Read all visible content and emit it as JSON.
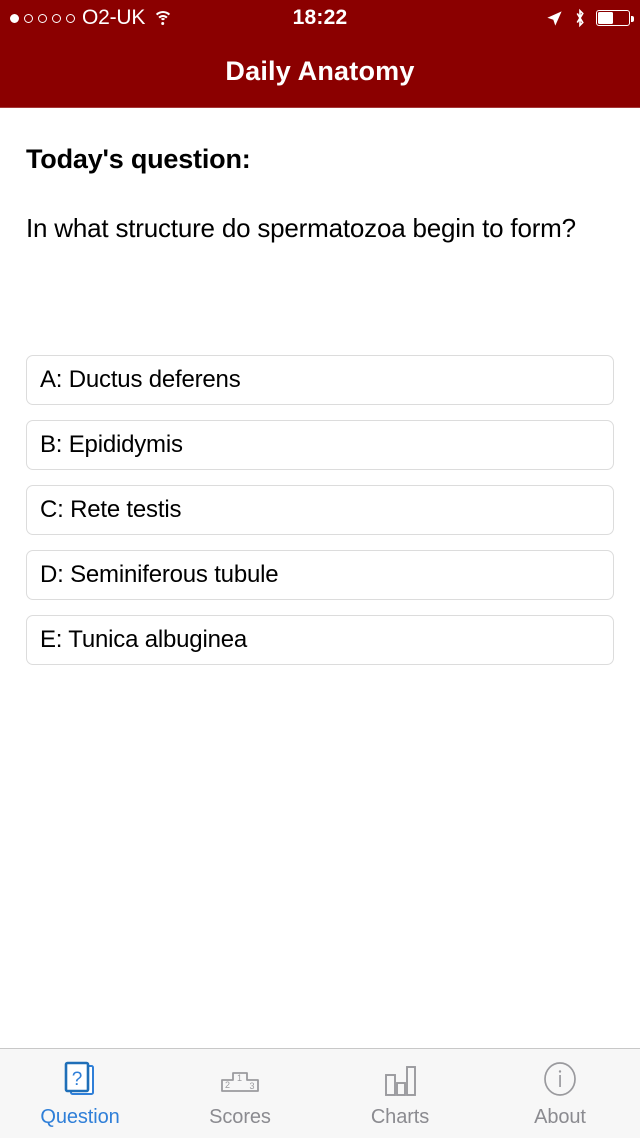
{
  "status_bar": {
    "carrier": "O2-UK",
    "signal_dots_total": 5,
    "signal_dots_filled": 1,
    "wifi_icon": "wifi-icon",
    "time": "18:22",
    "location_icon": "location-arrow-icon",
    "bluetooth_icon": "bluetooth-icon",
    "battery_icon": "battery-icon",
    "battery_percent": 50,
    "background_color": "#8B0000",
    "text_color": "#FFFFFF"
  },
  "navbar": {
    "title": "Daily Anatomy",
    "background_color": "#8B0000",
    "text_color": "#FFFFFF"
  },
  "main": {
    "heading": "Today's question:",
    "question": "In what structure do spermatozoa begin to form?",
    "options": [
      {
        "label": "A: Ductus deferens"
      },
      {
        "label": "B: Epididymis"
      },
      {
        "label": "C: Rete testis"
      },
      {
        "label": "D: Seminiferous tubule"
      },
      {
        "label": "E: Tunica albuginea"
      }
    ]
  },
  "tabbar": {
    "active_color": "#2F7FD8",
    "inactive_color": "#8B8B90",
    "background_color": "#F7F7F7",
    "items": [
      {
        "label": "Question",
        "icon": "question-cards-icon",
        "active": true
      },
      {
        "label": "Scores",
        "icon": "podium-icon",
        "active": false
      },
      {
        "label": "Charts",
        "icon": "bar-chart-icon",
        "active": false
      },
      {
        "label": "About",
        "icon": "info-circle-icon",
        "active": false
      }
    ]
  }
}
